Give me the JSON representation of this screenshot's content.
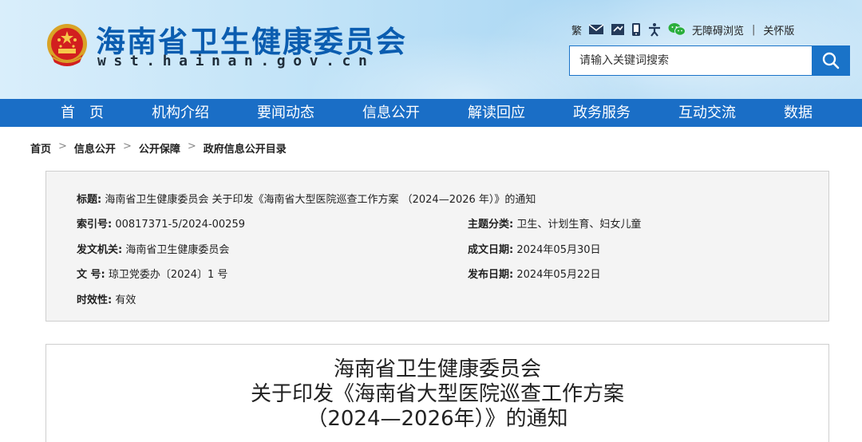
{
  "header": {
    "site_title": "海南省卫生健康委员会",
    "site_url": "wst.hainan.gov.cn",
    "emblem_icon": "national-emblem-icon",
    "tools": {
      "traditional": "繁",
      "mail_icon": "mail-icon",
      "weibo_icon": "weibo-icon",
      "mobile_icon": "mobile-icon",
      "accessibility_person_icon": "accessibility-icon",
      "wechat_icon": "wechat-icon",
      "barrier_free": "无障碍浏览",
      "separator": "|",
      "elder_mode": "关怀版"
    },
    "search": {
      "placeholder": "请输入关键词搜索",
      "button_icon": "search-icon"
    },
    "colors": {
      "brand_blue": "#1a6ec6",
      "title_blue": "#0b5db0"
    }
  },
  "nav": {
    "items": [
      "首　页",
      "机构介绍",
      "要闻动态",
      "信息公开",
      "解读回应",
      "政务服务",
      "互动交流",
      "数据"
    ]
  },
  "breadcrumb": {
    "items": [
      "首页",
      "信息公开",
      "公开保障",
      "政府信息公开目录"
    ],
    "separator": ">"
  },
  "meta": {
    "title_label": "标题:",
    "title_value": "海南省卫生健康委员会 关于印发《海南省大型医院巡查工作方案 （2024—2026 年）》的通知",
    "index_label": "索引号:",
    "index_value": "00817371-5/2024-00259",
    "topic_label": "主题分类:",
    "topic_value": "卫生、计划生育、妇女儿童",
    "issuer_label": "发文机关:",
    "issuer_value": "海南省卫生健康委员会",
    "created_label": "成文日期:",
    "created_value": "2024年05月30日",
    "docno_label": "文 号:",
    "docno_value": "琼卫党委办〔2024〕1 号",
    "published_label": "发布日期:",
    "published_value": "2024年05月22日",
    "validity_label": "时效性:",
    "validity_value": "有效"
  },
  "article": {
    "title_line1": "海南省卫生健康委员会",
    "title_line2": "关于印发《海南省大型医院巡查工作方案",
    "title_line3": "（2024—2026年）》的通知"
  }
}
